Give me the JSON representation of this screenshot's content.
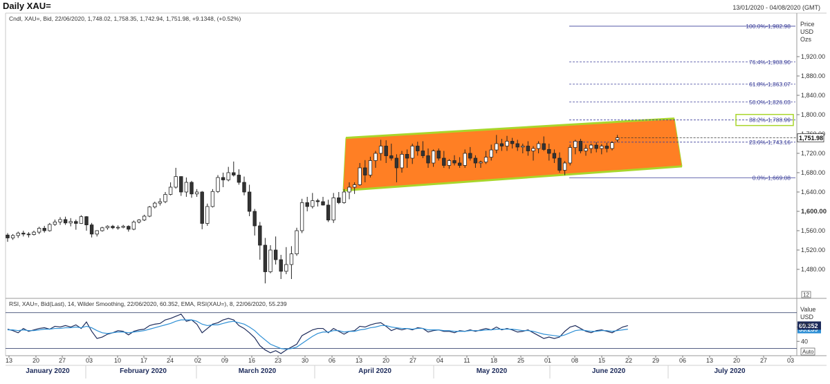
{
  "header": {
    "title": "Daily XAU=",
    "date_range": "13/01/2020 - 04/08/2020 (GMT)"
  },
  "colors": {
    "up_candle": "#ffffff",
    "down_candle": "#333333",
    "channel_fill": "#ff7f24",
    "channel_border": "#a9d62b",
    "fib_line": "#3b3f9a",
    "rsi_line": "#1c2a5a",
    "ema_line": "#2d8fd5",
    "rsi_badge": "#1c2a5a",
    "ema_badge": "#2d8fd5"
  },
  "chart_data": [
    {
      "type": "candlestick",
      "legend": "Cndl, XAU=, Bid, 22/06/2020, 1,748.02, 1,758.35, 1,742.94, 1,751.98, +9.1348, (+0.52%)",
      "axis_title": [
        "Price",
        "USD",
        "Ozs"
      ],
      "ylim": [
        1420,
        2010
      ],
      "y_ticks": [
        1480,
        1520,
        1560,
        1600,
        1640,
        1680,
        1720,
        1760,
        1800,
        1840,
        1880,
        1920
      ],
      "y_tick_labels": [
        "1,480.00",
        "1,520.00",
        "1,560.00",
        "1,600.00",
        "1,640.00",
        "1,680.00",
        "1,720.00",
        "1,760.00",
        "1,800.00",
        "1,840.00",
        "1,880.00",
        "1,920.00"
      ],
      "last_price": 1751.98,
      "last_price_label": "1,751.98",
      "x_day_ticks": [
        "13",
        "20",
        "27",
        "03",
        "10",
        "17",
        "24",
        "02",
        "09",
        "16",
        "23",
        "30",
        "06",
        "13",
        "20",
        "27",
        "04",
        "11",
        "18",
        "25",
        "01",
        "08",
        "15",
        "22",
        "29",
        "06",
        "13",
        "20",
        "27",
        "03"
      ],
      "x_month_labels": [
        "January 2020",
        "February 2020",
        "March 2020",
        "April 2020",
        "May 2020",
        "June 2020",
        "July 2020"
      ],
      "ohlc": [
        [
          1551,
          1555,
          1537,
          1545
        ],
        [
          1545,
          1553,
          1541,
          1550
        ],
        [
          1550,
          1558,
          1545,
          1555
        ],
        [
          1555,
          1560,
          1548,
          1553
        ],
        [
          1553,
          1557,
          1546,
          1552
        ],
        [
          1552,
          1560,
          1550,
          1557
        ],
        [
          1557,
          1568,
          1553,
          1565
        ],
        [
          1565,
          1570,
          1556,
          1560
        ],
        [
          1560,
          1576,
          1558,
          1573
        ],
        [
          1573,
          1583,
          1570,
          1578
        ],
        [
          1578,
          1588,
          1572,
          1583
        ],
        [
          1583,
          1589,
          1572,
          1576
        ],
        [
          1576,
          1586,
          1569,
          1579
        ],
        [
          1579,
          1583,
          1562,
          1575
        ],
        [
          1575,
          1592,
          1574,
          1589
        ],
        [
          1589,
          1590,
          1560,
          1572
        ],
        [
          1572,
          1576,
          1546,
          1553
        ],
        [
          1553,
          1561,
          1548,
          1560
        ],
        [
          1560,
          1568,
          1558,
          1566
        ],
        [
          1566,
          1571,
          1562,
          1569
        ],
        [
          1569,
          1572,
          1563,
          1566
        ],
        [
          1566,
          1571,
          1562,
          1567
        ],
        [
          1567,
          1572,
          1565,
          1569
        ],
        [
          1569,
          1571,
          1558,
          1563
        ],
        [
          1563,
          1581,
          1561,
          1578
        ],
        [
          1578,
          1584,
          1575,
          1582
        ],
        [
          1582,
          1593,
          1580,
          1590
        ],
        [
          1590,
          1611,
          1588,
          1609
        ],
        [
          1609,
          1620,
          1606,
          1617
        ],
        [
          1617,
          1627,
          1612,
          1620
        ],
        [
          1620,
          1640,
          1617,
          1635
        ],
        [
          1635,
          1660,
          1633,
          1650
        ],
        [
          1650,
          1690,
          1647,
          1672
        ],
        [
          1672,
          1672,
          1632,
          1640
        ],
        [
          1640,
          1670,
          1630,
          1660
        ],
        [
          1660,
          1663,
          1628,
          1636
        ],
        [
          1636,
          1646,
          1630,
          1640
        ],
        [
          1640,
          1642,
          1563,
          1575
        ],
        [
          1575,
          1616,
          1570,
          1610
        ],
        [
          1610,
          1646,
          1608,
          1641
        ],
        [
          1641,
          1675,
          1638,
          1670
        ],
        [
          1670,
          1680,
          1650,
          1665
        ],
        [
          1665,
          1692,
          1662,
          1680
        ],
        [
          1680,
          1703,
          1672,
          1675
        ],
        [
          1675,
          1687,
          1655,
          1660
        ],
        [
          1660,
          1672,
          1633,
          1640
        ],
        [
          1640,
          1655,
          1590,
          1600
        ],
        [
          1600,
          1605,
          1550,
          1570
        ],
        [
          1570,
          1578,
          1500,
          1530
        ],
        [
          1530,
          1545,
          1451,
          1475
        ],
        [
          1475,
          1530,
          1472,
          1520
        ],
        [
          1520,
          1548,
          1490,
          1500
        ],
        [
          1500,
          1510,
          1460,
          1476
        ],
        [
          1476,
          1526,
          1470,
          1490
        ],
        [
          1490,
          1528,
          1460,
          1512
        ],
        [
          1512,
          1566,
          1508,
          1560
        ],
        [
          1560,
          1626,
          1555,
          1618
        ],
        [
          1618,
          1630,
          1600,
          1610
        ],
        [
          1610,
          1638,
          1606,
          1622
        ],
        [
          1622,
          1626,
          1610,
          1620
        ],
        [
          1620,
          1630,
          1612,
          1613
        ],
        [
          1613,
          1624,
          1578,
          1582
        ],
        [
          1582,
          1638,
          1576,
          1628
        ],
        [
          1628,
          1640,
          1615,
          1618
        ],
        [
          1618,
          1646,
          1616,
          1640
        ],
        [
          1640,
          1660,
          1625,
          1650
        ],
        [
          1650,
          1660,
          1636,
          1655
        ],
        [
          1655,
          1700,
          1653,
          1690
        ],
        [
          1690,
          1706,
          1660,
          1675
        ],
        [
          1675,
          1713,
          1670,
          1705
        ],
        [
          1705,
          1725,
          1690,
          1720
        ],
        [
          1720,
          1748,
          1705,
          1735
        ],
        [
          1735,
          1747,
          1700,
          1715
        ],
        [
          1715,
          1740,
          1705,
          1710
        ],
        [
          1710,
          1718,
          1660,
          1690
        ],
        [
          1690,
          1725,
          1680,
          1718
        ],
        [
          1718,
          1728,
          1690,
          1710
        ],
        [
          1710,
          1740,
          1698,
          1735
        ],
        [
          1735,
          1744,
          1715,
          1725
        ],
        [
          1725,
          1745,
          1710,
          1715
        ],
        [
          1715,
          1730,
          1690,
          1700
        ],
        [
          1700,
          1728,
          1692,
          1725
        ],
        [
          1725,
          1730,
          1705,
          1710
        ],
        [
          1710,
          1725,
          1690,
          1695
        ],
        [
          1695,
          1708,
          1688,
          1705
        ],
        [
          1705,
          1716,
          1695,
          1700
        ],
        [
          1700,
          1712,
          1690,
          1695
        ],
        [
          1695,
          1728,
          1690,
          1720
        ],
        [
          1720,
          1733,
          1705,
          1710
        ],
        [
          1710,
          1716,
          1690,
          1700
        ],
        [
          1700,
          1705,
          1690,
          1702
        ],
        [
          1702,
          1725,
          1698,
          1712
        ],
        [
          1712,
          1738,
          1705,
          1727
        ],
        [
          1727,
          1758,
          1720,
          1740
        ],
        [
          1740,
          1750,
          1725,
          1735
        ],
        [
          1735,
          1756,
          1725,
          1745
        ],
        [
          1745,
          1752,
          1730,
          1740
        ],
        [
          1740,
          1748,
          1725,
          1733
        ],
        [
          1733,
          1740,
          1720,
          1735
        ],
        [
          1735,
          1745,
          1715,
          1725
        ],
        [
          1725,
          1735,
          1705,
          1730
        ],
        [
          1730,
          1745,
          1720,
          1740
        ],
        [
          1740,
          1755,
          1725,
          1728
        ],
        [
          1728,
          1740,
          1705,
          1720
        ],
        [
          1720,
          1728,
          1700,
          1710
        ],
        [
          1710,
          1722,
          1680,
          1685
        ],
        [
          1685,
          1704,
          1675,
          1700
        ],
        [
          1700,
          1738,
          1695,
          1732
        ],
        [
          1732,
          1748,
          1718,
          1745
        ],
        [
          1745,
          1750,
          1720,
          1725
        ],
        [
          1725,
          1738,
          1715,
          1730
        ],
        [
          1730,
          1740,
          1720,
          1737
        ],
        [
          1737,
          1743,
          1722,
          1730
        ],
        [
          1730,
          1739,
          1718,
          1735
        ],
        [
          1735,
          1742,
          1722,
          1730
        ],
        [
          1730,
          1745,
          1726,
          1742
        ],
        [
          1748,
          1758,
          1743,
          1752
        ]
      ],
      "channel": {
        "upper_start": 1752,
        "upper_end": 1792,
        "lower_start": 1643,
        "lower_end": 1693
      },
      "fib_levels": [
        {
          "value": 1982.98,
          "label": "100.0%-1,982.98"
        },
        {
          "value": 1908.9,
          "label": "76.4%-1,908.90"
        },
        {
          "value": 1863.07,
          "label": "61.8%-1,863.07"
        },
        {
          "value": 1826.03,
          "label": "50.0%-1,826.03"
        },
        {
          "value": 1788.99,
          "label": "38.2%-1,788.99",
          "highlighted": true
        },
        {
          "value": 1743.16,
          "label": "23.6%-1,743.16"
        },
        {
          "value": 1669.08,
          "label": "0.0%-1,669.08"
        }
      ],
      "scale_badge": "12"
    },
    {
      "type": "line",
      "legend": "RSI, XAU=, Bid(Last), 14, Wilder Smoothing, 22/06/2020, 60.352, EMA, RSI(XAU=), 8, 22/06/2020, 55.239",
      "axis_title": [
        "Value",
        "USD",
        "Ozs"
      ],
      "ylim": [
        20,
        100
      ],
      "y_ticks": [
        40,
        60
      ],
      "y_tick_labels": [
        "40",
        "60"
      ],
      "reference_lines": [
        80,
        30
      ],
      "auto_label": "Auto",
      "series": [
        {
          "name": "RSI",
          "last_label": "60.352",
          "values": [
            57,
            55,
            52,
            58,
            54,
            56,
            58,
            59,
            57,
            61,
            60,
            62,
            60,
            63,
            58,
            67,
            54,
            44,
            46,
            50,
            52,
            55,
            54,
            49,
            54,
            56,
            57,
            62,
            64,
            65,
            70,
            72,
            75,
            78,
            68,
            70,
            64,
            52,
            58,
            64,
            66,
            70,
            72,
            70,
            62,
            58,
            52,
            45,
            34,
            28,
            24,
            27,
            23,
            28,
            32,
            36,
            48,
            52,
            56,
            58,
            58,
            52,
            58,
            54,
            50,
            54,
            55,
            61,
            60,
            63,
            65,
            66,
            61,
            55,
            58,
            56,
            58,
            56,
            59,
            58,
            53,
            55,
            56,
            54,
            54,
            52,
            55,
            54,
            56,
            54,
            56,
            58,
            56,
            60,
            56,
            58,
            56,
            53,
            54,
            56,
            52,
            48,
            44,
            46,
            44,
            46,
            54,
            60,
            62,
            58,
            54,
            52,
            55,
            56,
            54,
            52,
            56,
            60,
            62
          ]
        },
        {
          "name": "EMA",
          "last_label": "55.239",
          "values": [
            56,
            56,
            55,
            56,
            55,
            55,
            56,
            57,
            57,
            58,
            58,
            59,
            59,
            60,
            59,
            61,
            59,
            55,
            52,
            51,
            52,
            53,
            53,
            52,
            53,
            54,
            55,
            57,
            59,
            61,
            63,
            65,
            68,
            70,
            70,
            70,
            68,
            64,
            62,
            63,
            63,
            65,
            67,
            68,
            66,
            64,
            60,
            55,
            48,
            42,
            36,
            33,
            30,
            29,
            30,
            32,
            37,
            42,
            47,
            51,
            53,
            53,
            55,
            55,
            53,
            54,
            54,
            56,
            57,
            59,
            60,
            62,
            62,
            60,
            59,
            58,
            58,
            57,
            58,
            58,
            56,
            56,
            56,
            55,
            55,
            54,
            54,
            54,
            55,
            55,
            55,
            56,
            56,
            57,
            57,
            57,
            57,
            56,
            55,
            55,
            54,
            52,
            50,
            49,
            48,
            47,
            49,
            52,
            55,
            56,
            55,
            54,
            54,
            55,
            55,
            54,
            55,
            56,
            57
          ]
        }
      ]
    }
  ]
}
